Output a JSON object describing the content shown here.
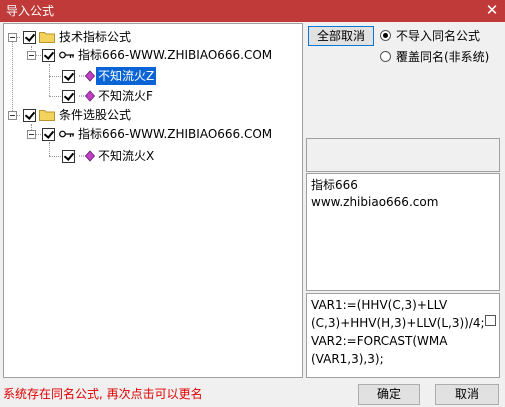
{
  "window": {
    "title": "导入公式",
    "close_glyph": "✕"
  },
  "tree": {
    "groups": [
      {
        "label": "技术指标公式",
        "source": "指标666-WWW.ZHIBIAO666.COM",
        "items": [
          "不知流火Z",
          "不知流火F"
        ]
      },
      {
        "label": "条件选股公式",
        "source": "指标666-WWW.ZHIBIAO666.COM",
        "items": [
          "不知流火X"
        ]
      }
    ],
    "selected_item": "不知流火Z"
  },
  "toolbar": {
    "cancel_all_label": "全部取消"
  },
  "options": {
    "no_import_label": "不导入同名公式",
    "overwrite_label": "覆盖同名(非系统)",
    "selected": "no_import"
  },
  "info": {
    "name": "指标666",
    "website": "www.zhibiao666.com"
  },
  "code": {
    "lines": [
      "VAR1:=(HHV(C,3)+LLV",
      "(C,3)+HHV(H,3)+LLV(L,3))/4;",
      "VAR2:=FORCAST(WMA",
      "(VAR1,3),3);"
    ]
  },
  "status": {
    "message": "系统存在同名公式, 再次点击可以更名"
  },
  "buttons": {
    "ok_label": "确定",
    "cancel_label": "取消"
  }
}
